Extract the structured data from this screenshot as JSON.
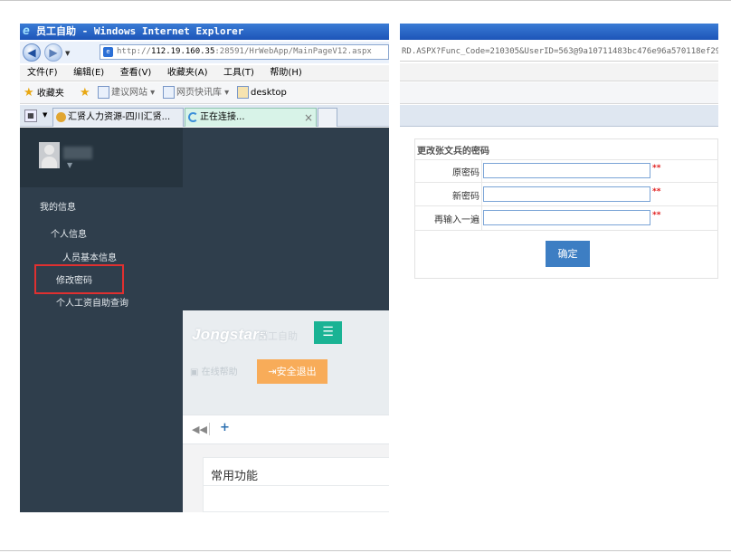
{
  "left_window": {
    "title": "员工自助 - Windows Internet Explorer",
    "address_prefix": "http://",
    "address_host": "112.19.160.35",
    "address_rest": ":28591/HrWebApp/MainPageV12.aspx",
    "menu": [
      "文件(F)",
      "编辑(E)",
      "查看(V)",
      "收藏夹(A)",
      "工具(T)",
      "帮助(H)"
    ],
    "favorites": {
      "label": "收藏夹",
      "suggest_sites": "建议网站",
      "web_slice": "网页快讯库",
      "desktop": "desktop"
    },
    "tabs": [
      "汇贤人力资源-四川汇贤...",
      "正在连接..."
    ],
    "tab_close": "×"
  },
  "sidebar": {
    "section": "我的信息",
    "group": "个人信息",
    "items": [
      "人员基本信息",
      "修改密码",
      "个人工资自助查询"
    ]
  },
  "app_header": {
    "brand": "Jongstars",
    "brand_sub": "员工自助",
    "menu_icon": "☰",
    "help": "在线帮助",
    "logout": "安全退出"
  },
  "content": {
    "panel_title": "常用功能"
  },
  "right_window": {
    "address": "RD.ASPX?Func_Code=210305&UserID=563@9a10711483bc476e96a570118ef29134"
  },
  "password_form": {
    "title": "更改张文兵的密码",
    "fields": [
      {
        "label": "原密码",
        "value": "",
        "required": "**"
      },
      {
        "label": "新密码",
        "value": "",
        "required": "**"
      },
      {
        "label": "再输入一遍",
        "value": "",
        "required": "**"
      }
    ],
    "submit": "确定"
  }
}
